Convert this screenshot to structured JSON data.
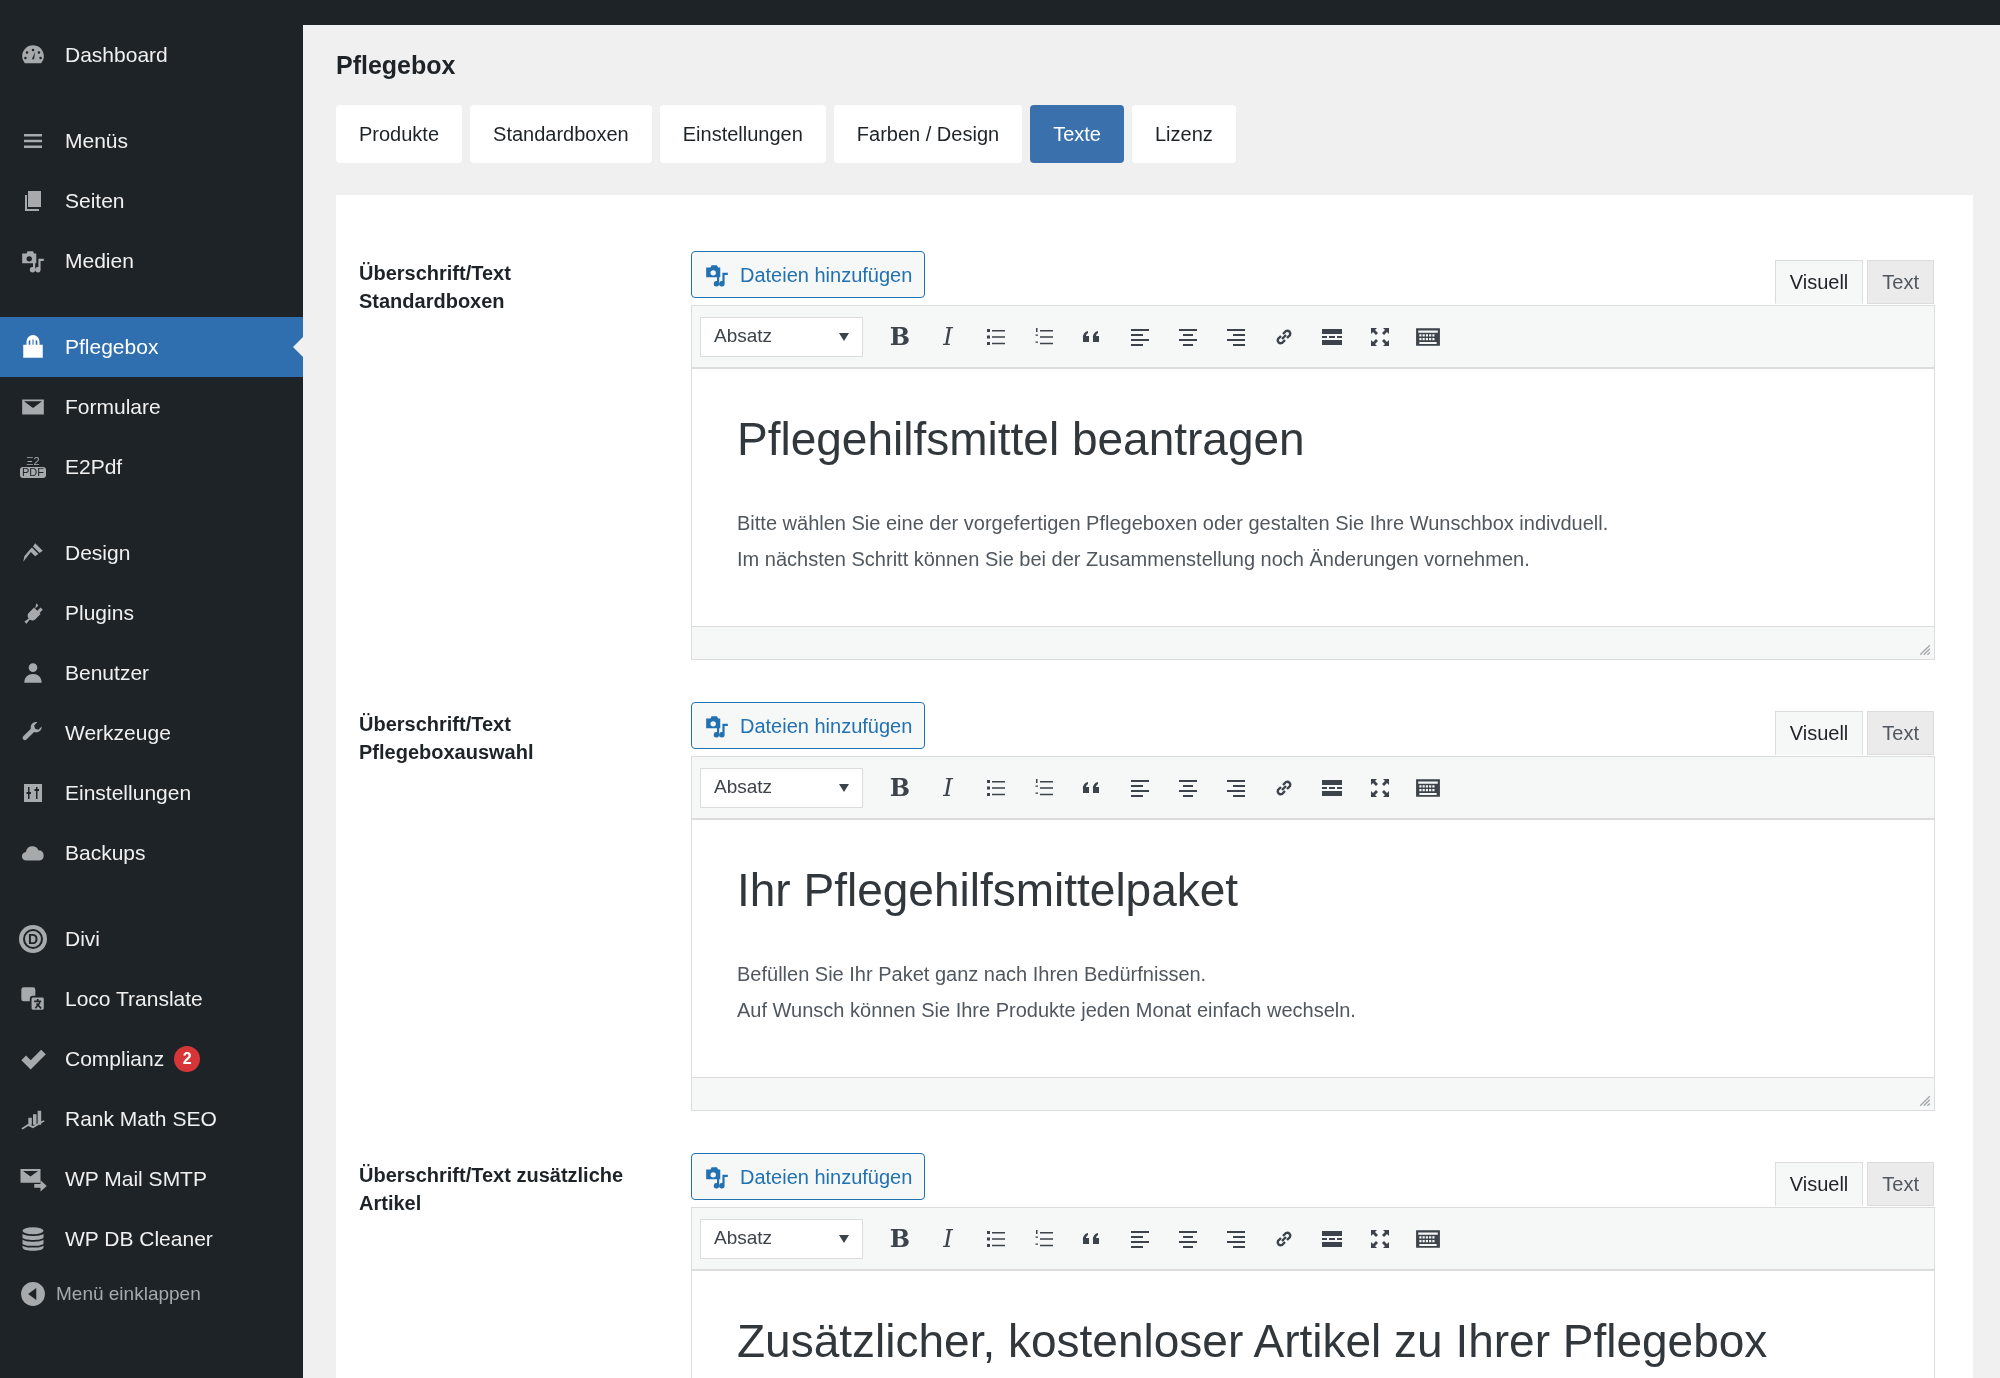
{
  "sidebar": {
    "groups": [
      {
        "items": [
          {
            "label": "Dashboard",
            "kind": "gauge",
            "selected": false
          }
        ]
      },
      {
        "items": [
          {
            "label": "Menüs",
            "kind": "lines",
            "selected": false
          },
          {
            "label": "Seiten",
            "kind": "pages",
            "selected": false
          },
          {
            "label": "Medien",
            "kind": "media",
            "selected": false
          }
        ]
      },
      {
        "items": [
          {
            "label": "Pflegebox",
            "kind": "bag",
            "selected": true
          },
          {
            "label": "Formulare",
            "kind": "mail",
            "selected": false
          },
          {
            "label": "E2Pdf",
            "kind": "pdf",
            "icon_text": [
              "Ξ2",
              "PDF"
            ],
            "selected": false
          }
        ]
      },
      {
        "items": [
          {
            "label": "Design",
            "kind": "brush",
            "selected": false
          },
          {
            "label": "Plugins",
            "kind": "plug",
            "selected": false
          },
          {
            "label": "Benutzer",
            "kind": "user",
            "selected": false
          },
          {
            "label": "Werkzeuge",
            "kind": "wrench",
            "selected": false
          },
          {
            "label": "Einstellungen",
            "kind": "sliders",
            "selected": false
          },
          {
            "label": "Backups",
            "kind": "cloud",
            "selected": false
          }
        ]
      },
      {
        "items": [
          {
            "label": "Divi",
            "kind": "circle",
            "icon_text": [
              "D"
            ],
            "selected": false
          },
          {
            "label": "Loco Translate",
            "kind": "translate",
            "selected": false
          },
          {
            "label": "Complianz",
            "kind": "check",
            "badge": "2",
            "selected": false
          },
          {
            "label": "Rank Math SEO",
            "kind": "chart",
            "selected": false
          },
          {
            "label": "WP Mail SMTP",
            "kind": "mailsend",
            "selected": false
          },
          {
            "label": "WP DB Cleaner",
            "kind": "db",
            "selected": false
          }
        ]
      }
    ],
    "collapse": "Menü einklappen"
  },
  "page": {
    "title": "Pflegebox",
    "tabs": [
      {
        "label": "Produkte",
        "selected": false
      },
      {
        "label": "Standardboxen",
        "selected": false
      },
      {
        "label": "Einstellungen",
        "selected": false
      },
      {
        "label": "Farben / Design",
        "selected": false
      },
      {
        "label": "Texte",
        "selected": true
      },
      {
        "label": "Lizenz",
        "selected": false
      }
    ],
    "sections": [
      {
        "label_lines": [
          "Überschrift/Text",
          "Standardboxen"
        ],
        "add_media": "Dateien hinzufügen",
        "modes": [
          {
            "label": "Visuell",
            "selected": true
          },
          {
            "label": "Text",
            "selected": false
          }
        ],
        "format": "Absatz",
        "bold": "B",
        "italic": "I",
        "heading": "Pflegehilfsmittel beantragen",
        "paragraphs": [
          "Bitte wählen Sie eine der vorgefertigen Pflegeboxen oder gestalten Sie Ihre Wunschbox indivduell.",
          "Im nächsten Schritt können Sie bei der Zusammenstellung noch Änderungen vornehmen."
        ],
        "resize_handle": true
      },
      {
        "label_lines": [
          "Überschrift/Text",
          "Pflegeboxauswahl"
        ],
        "add_media": "Dateien hinzufügen",
        "modes": [
          {
            "label": "Visuell",
            "selected": true
          },
          {
            "label": "Text",
            "selected": false
          }
        ],
        "format": "Absatz",
        "bold": "B",
        "italic": "I",
        "heading": "Ihr Pflegehilfsmittelpaket",
        "paragraphs": [
          "Befüllen Sie Ihr Paket ganz nach Ihren Bedürfnissen.",
          "Auf Wunsch können Sie Ihre Produkte jeden Monat einfach wechseln."
        ],
        "resize_handle": true
      },
      {
        "label_lines": [
          "Überschrift/Text zusätzliche",
          "Artikel"
        ],
        "add_media": "Dateien hinzufügen",
        "modes": [
          {
            "label": "Visuell",
            "selected": true
          },
          {
            "label": "Text",
            "selected": false
          }
        ],
        "format": "Absatz",
        "bold": "B",
        "italic": "I",
        "heading": "Zusätzlicher, kostenloser Artikel zu Ihrer Pflegebox"
      }
    ],
    "toolbar": [
      {
        "kind": "bold"
      },
      {
        "kind": "italic"
      },
      {
        "kind": "bullets"
      },
      {
        "kind": "numbers"
      },
      {
        "kind": "quote"
      },
      {
        "kind": "align-left"
      },
      {
        "kind": "align-center"
      },
      {
        "kind": "align-right"
      },
      {
        "kind": "link"
      },
      {
        "kind": "more"
      },
      {
        "kind": "fullscreen"
      },
      {
        "kind": "keyboard"
      }
    ]
  }
}
